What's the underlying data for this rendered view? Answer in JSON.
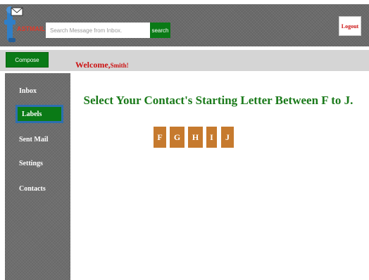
{
  "header": {
    "logo_text": "ASTMAIL",
    "search": {
      "placeholder": "Search Message from Inbox.",
      "value": ""
    },
    "search_button": "search",
    "logout_button": "Logout"
  },
  "subbar": {
    "compose_button": "Compose",
    "welcome_prefix": "Welcome,",
    "username": "Smith!"
  },
  "sidebar": {
    "items": [
      {
        "label": "Inbox",
        "active": false
      },
      {
        "label": "Labels",
        "active": true
      },
      {
        "label": "Sent Mail",
        "active": false
      },
      {
        "label": "Settings",
        "active": false
      },
      {
        "label": "Contacts",
        "active": false
      }
    ]
  },
  "main": {
    "heading": "Select Your Contact's Starting Letter Between F to J.",
    "letters": [
      "F",
      "G",
      "H",
      "I",
      "J"
    ]
  },
  "colors": {
    "green": "#0a7a16",
    "heading_green": "#1a7a1a",
    "welcome_red": "#cc1111",
    "letter_orange": "#c67a2e",
    "active_border": "#2d6fb0",
    "header_gray": "#6b6b6b"
  }
}
